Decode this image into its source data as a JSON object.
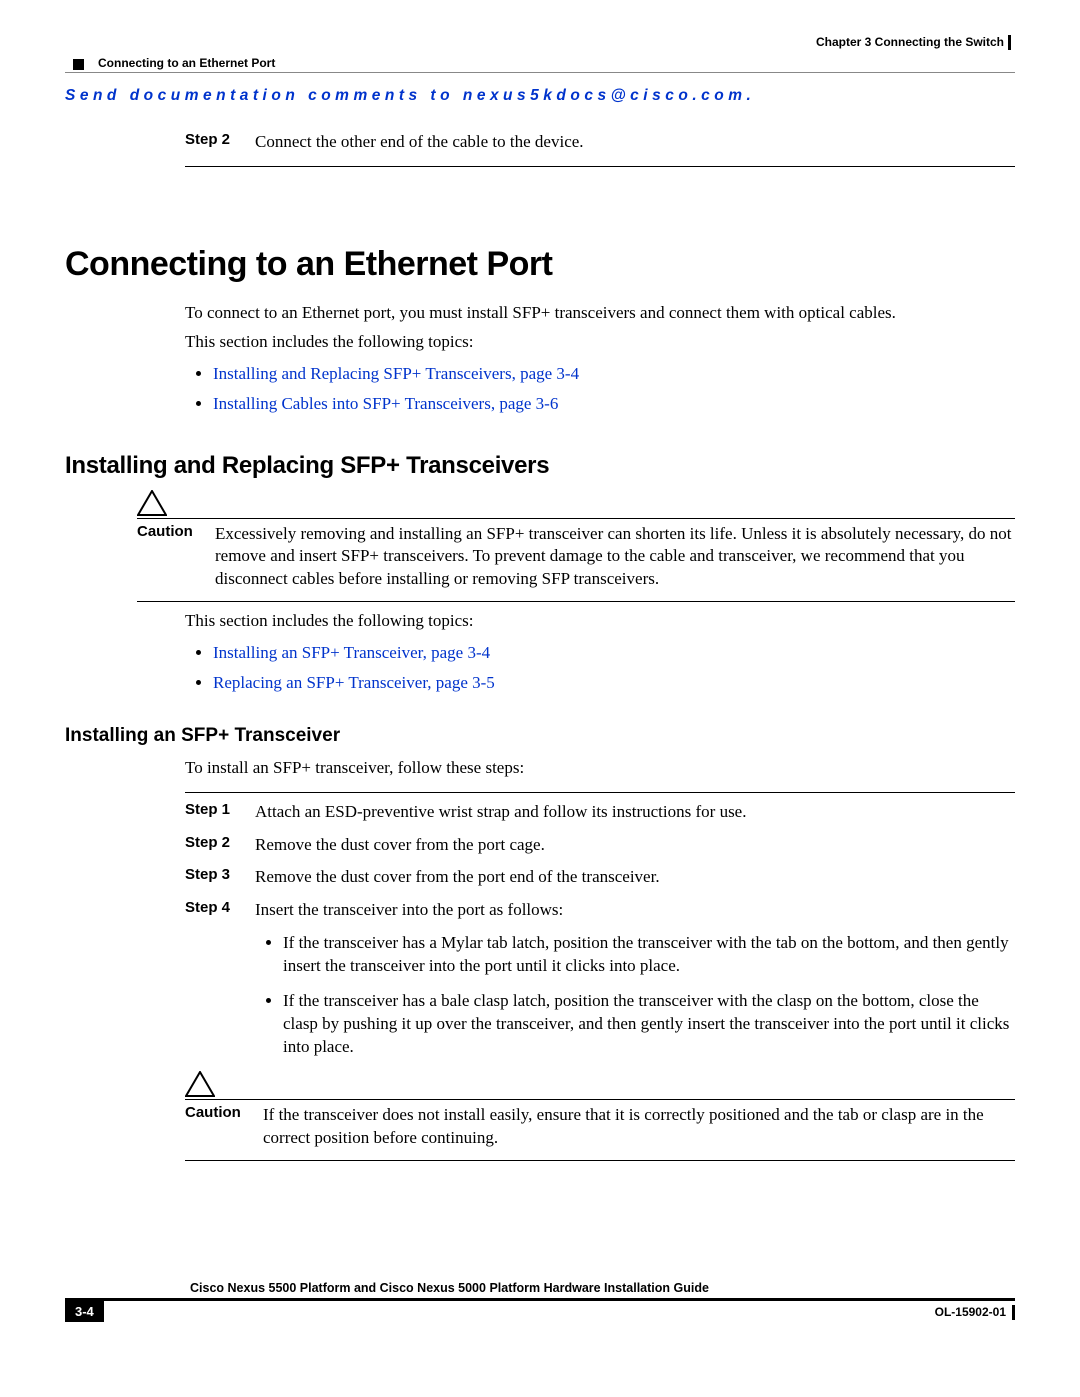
{
  "header": {
    "chapter": "Chapter 3      Connecting the Switch",
    "section": "Connecting to an Ethernet Port"
  },
  "email_line": "Send documentation comments to nexus5kdocs@cisco.com.",
  "top_step": {
    "label": "Step 2",
    "text": "Connect the other end of the cable to the device."
  },
  "h1": "Connecting to an Ethernet Port",
  "intro1": "To connect to an Ethernet port, you must install SFP+ transceivers and connect them with optical cables.",
  "intro2": "This section includes the following topics:",
  "xrefs1": [
    "Installing and Replacing SFP+ Transceivers, page 3-4",
    "Installing Cables into SFP+ Transceivers, page 3-6"
  ],
  "h2": "Installing and Replacing SFP+ Transceivers",
  "caution1": {
    "label": "Caution",
    "text": "Excessively removing and installing an SFP+ transceiver can shorten its life. Unless it is absolutely necessary, do not remove and insert SFP+ transceivers. To prevent damage to the cable and transceiver, we recommend that you disconnect cables before installing or removing SFP transceivers."
  },
  "subintro": "This section includes the following topics:",
  "xrefs2": [
    "Installing an SFP+ Transceiver, page 3-4",
    "Replacing an SFP+ Transceiver, page 3-5"
  ],
  "h3": "Installing an SFP+ Transceiver",
  "h3_intro": "To install an SFP+ transceiver, follow these steps:",
  "steps": [
    {
      "label": "Step 1",
      "text": "Attach an ESD-preventive wrist strap and follow its instructions for use."
    },
    {
      "label": "Step 2",
      "text": "Remove the dust cover from the port cage."
    },
    {
      "label": "Step 3",
      "text": "Remove the dust cover from the port end of the transceiver."
    },
    {
      "label": "Step 4",
      "text": "Insert the transceiver into the port as follows:"
    }
  ],
  "sub_bullets": [
    "If the transceiver has a Mylar tab latch, position the transceiver with the tab on the bottom, and then gently insert the transceiver into the port until it clicks into place.",
    "If the transceiver has a bale clasp latch, position the transceiver with the clasp on the bottom, close the clasp by pushing it up over the transceiver, and then gently insert the transceiver into the port until it clicks into place."
  ],
  "caution2": {
    "label": "Caution",
    "text": "If the transceiver does not install easily, ensure that it is correctly positioned and the tab or clasp are in the correct position before continuing."
  },
  "footer": {
    "title": "Cisco Nexus 5500 Platform and Cisco Nexus 5000 Platform Hardware Installation Guide",
    "page": "3-4",
    "docid": "OL-15902-01"
  }
}
